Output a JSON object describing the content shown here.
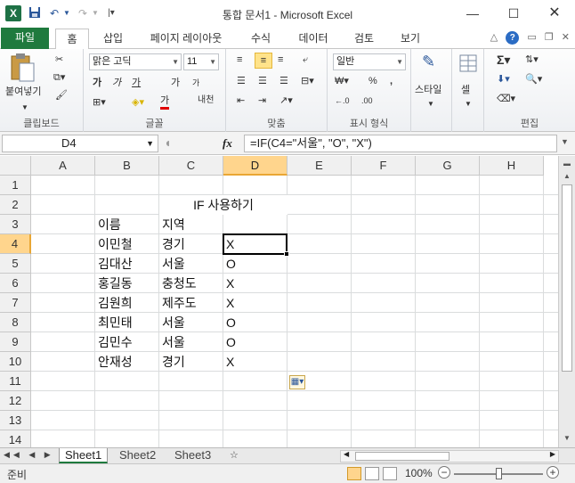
{
  "window": {
    "title": "통합 문서1 - Microsoft Excel",
    "app_icon": "X"
  },
  "qat": {
    "save": "save-icon",
    "undo": "undo-icon",
    "redo": "redo-icon"
  },
  "tabs": [
    {
      "label": "파일"
    },
    {
      "label": "홈"
    },
    {
      "label": "삽입"
    },
    {
      "label": "페이지 레이아웃"
    },
    {
      "label": "수식"
    },
    {
      "label": "데이터"
    },
    {
      "label": "검토"
    },
    {
      "label": "보기"
    }
  ],
  "ribbon": {
    "clipboard": {
      "paste": "붙여넣기",
      "label": "클립보드"
    },
    "font": {
      "name": "맑은 고딕",
      "size": "11",
      "bold": "가",
      "italic": "가",
      "underline": "가",
      "grow": "가",
      "shrink": "가",
      "ruby": "내천",
      "label": "글꼴"
    },
    "alignment": {
      "label": "맞춤"
    },
    "number": {
      "format": "일반",
      "percent": "%",
      "comma": ",",
      "dec_inc": "←.0",
      "dec_dec": ".00",
      "label": "표시 형식"
    },
    "styles": {
      "label": "스타일"
    },
    "cells": {
      "label": "셀"
    },
    "editing": {
      "sum": "Σ",
      "label": "편집"
    }
  },
  "formula_bar": {
    "name_box": "D4",
    "fx": "fx",
    "formula": "=IF(C4=\"서울\", \"O\", \"X\")"
  },
  "columns": [
    "A",
    "B",
    "C",
    "D",
    "E",
    "F",
    "G",
    "H"
  ],
  "rows": [
    "1",
    "2",
    "3",
    "4",
    "5",
    "6",
    "7",
    "8",
    "9",
    "10",
    "11",
    "12",
    "13",
    "14"
  ],
  "cells": {
    "title": "IF 사용하기",
    "header_name": "이름",
    "header_region": "지역",
    "data": [
      {
        "name": "이민철",
        "region": "경기",
        "result": "X"
      },
      {
        "name": "김대산",
        "region": "서울",
        "result": "O"
      },
      {
        "name": "홍길동",
        "region": "충청도",
        "result": "X"
      },
      {
        "name": "김원희",
        "region": "제주도",
        "result": "X"
      },
      {
        "name": "최민태",
        "region": "서울",
        "result": "O"
      },
      {
        "name": "김민수",
        "region": "서울",
        "result": "O"
      },
      {
        "name": "안재성",
        "region": "경기",
        "result": "X"
      }
    ]
  },
  "sheets": [
    "Sheet1",
    "Sheet2",
    "Sheet3"
  ],
  "status": {
    "ready": "준비",
    "zoom": "100%",
    "minus": "−",
    "plus": "+"
  },
  "colors": {
    "accent": "#1f7a3e",
    "selected_header": "#ffd58d"
  }
}
